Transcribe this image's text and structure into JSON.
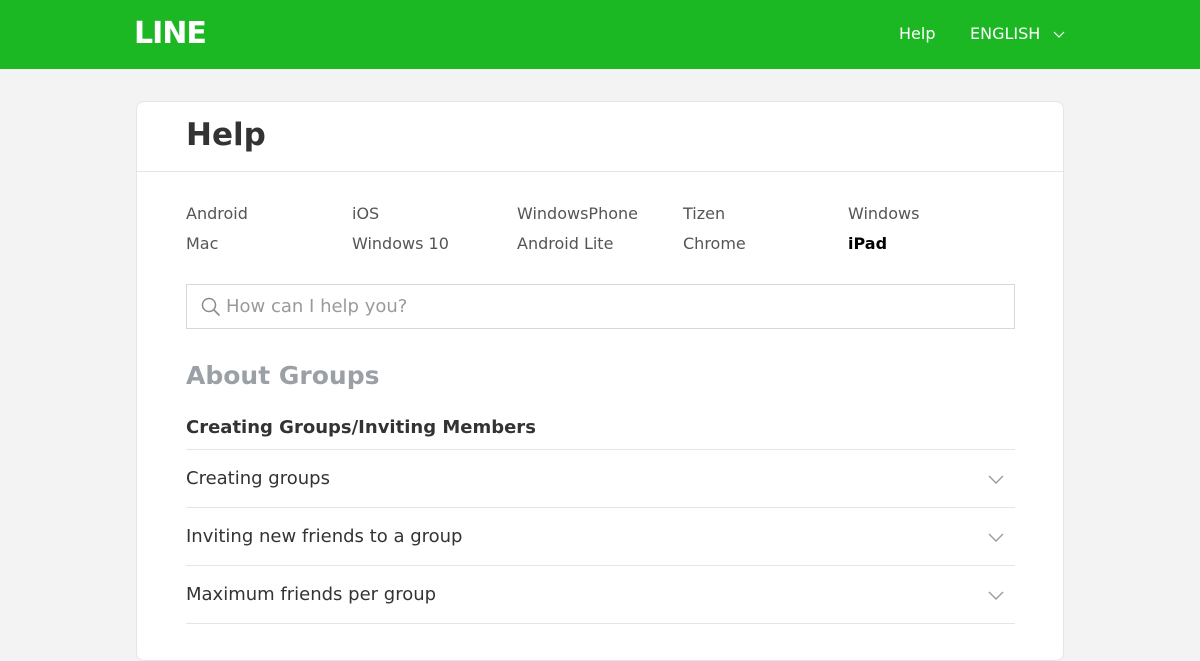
{
  "header": {
    "logo": "LINE",
    "help_link": "Help",
    "language": "ENGLISH",
    "brand_color": "#1cb824"
  },
  "page": {
    "title": "Help"
  },
  "platforms": [
    {
      "label": "Android",
      "active": false
    },
    {
      "label": "iOS",
      "active": false
    },
    {
      "label": "WindowsPhone",
      "active": false
    },
    {
      "label": "Tizen",
      "active": false
    },
    {
      "label": "Windows",
      "active": false
    },
    {
      "label": "Mac",
      "active": false
    },
    {
      "label": "Windows 10",
      "active": false
    },
    {
      "label": "Android Lite",
      "active": false
    },
    {
      "label": "Chrome",
      "active": false
    },
    {
      "label": "iPad",
      "active": true
    }
  ],
  "search": {
    "placeholder": "How can I help you?",
    "value": "",
    "icon": "search-icon"
  },
  "section": {
    "title": "About Groups",
    "subsection": "Creating Groups/Inviting Members",
    "items": [
      {
        "question": "Creating groups",
        "icon": "chevron-down-icon"
      },
      {
        "question": "Inviting new friends to a group",
        "icon": "chevron-down-icon"
      },
      {
        "question": "Maximum friends per group",
        "icon": "chevron-down-icon"
      }
    ]
  }
}
